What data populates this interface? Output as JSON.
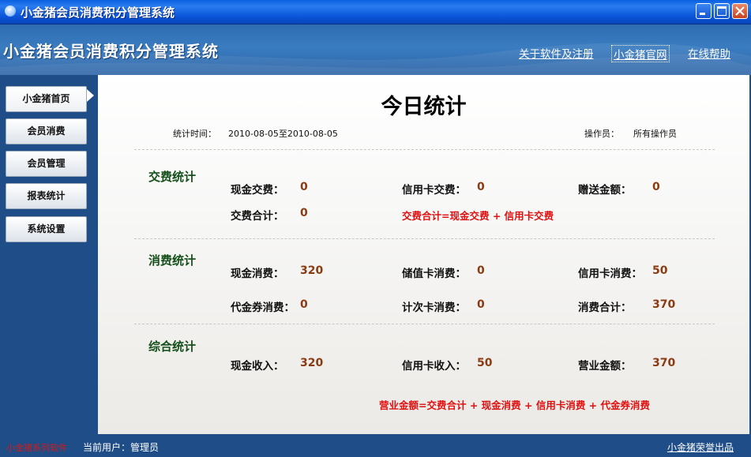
{
  "window": {
    "title": "小金猪会员消费积分管理系统"
  },
  "header": {
    "app_name": "小金猪会员消费积分管理系统",
    "links": {
      "about": "关于软件及注册",
      "website": "小金猪官网",
      "help": "在线帮助"
    }
  },
  "sidebar": {
    "items": [
      {
        "label": "小金猪首页"
      },
      {
        "label": "会员消费"
      },
      {
        "label": "会员管理"
      },
      {
        "label": "报表统计"
      },
      {
        "label": "系统设置"
      }
    ],
    "active_index": 0
  },
  "main": {
    "title": "今日统计",
    "stat_time_label": "统计时间：",
    "stat_time_value": "2010-08-05至2010-08-05",
    "operator_label": "操作员：",
    "operator_value": "所有操作员",
    "sections": {
      "fee": {
        "title": "交费统计",
        "cash_label": "现金交费：",
        "cash_value": "0",
        "card_label": "信用卡交费：",
        "card_value": "0",
        "gift_label": "赠送金额：",
        "gift_value": "0",
        "total_label": "交费合计：",
        "total_value": "0",
        "formula": "交费合计=现金交费 + 信用卡交费"
      },
      "consume": {
        "title": "消费统计",
        "cash_label": "现金消费：",
        "cash_value": "320",
        "stored_label": "储值卡消费：",
        "stored_value": "0",
        "credit_label": "信用卡消费：",
        "credit_value": "50",
        "voucher_label": "代金券消费：",
        "voucher_value": "0",
        "count_label": "计次卡消费：",
        "count_value": "0",
        "total_label": "消费合计：",
        "total_value": "370"
      },
      "summary": {
        "title": "综合统计",
        "cash_label": "现金收入：",
        "cash_value": "320",
        "credit_label": "信用卡收入：",
        "credit_value": "50",
        "revenue_label": "营业金额：",
        "revenue_value": "370",
        "formula": "营业金额=交费合计 + 现金消费 + 信用卡消费 + 代金券消费"
      }
    }
  },
  "status_bar": {
    "brand": "小金猪系列软件",
    "current_user": "当前用户：管理员",
    "maker": "小金猪荣誉出品"
  },
  "colors": {
    "sidebar_bg": "#1f4d87",
    "section_title": "#15501a",
    "value": "#8a3b12",
    "formula": "#e01010"
  }
}
